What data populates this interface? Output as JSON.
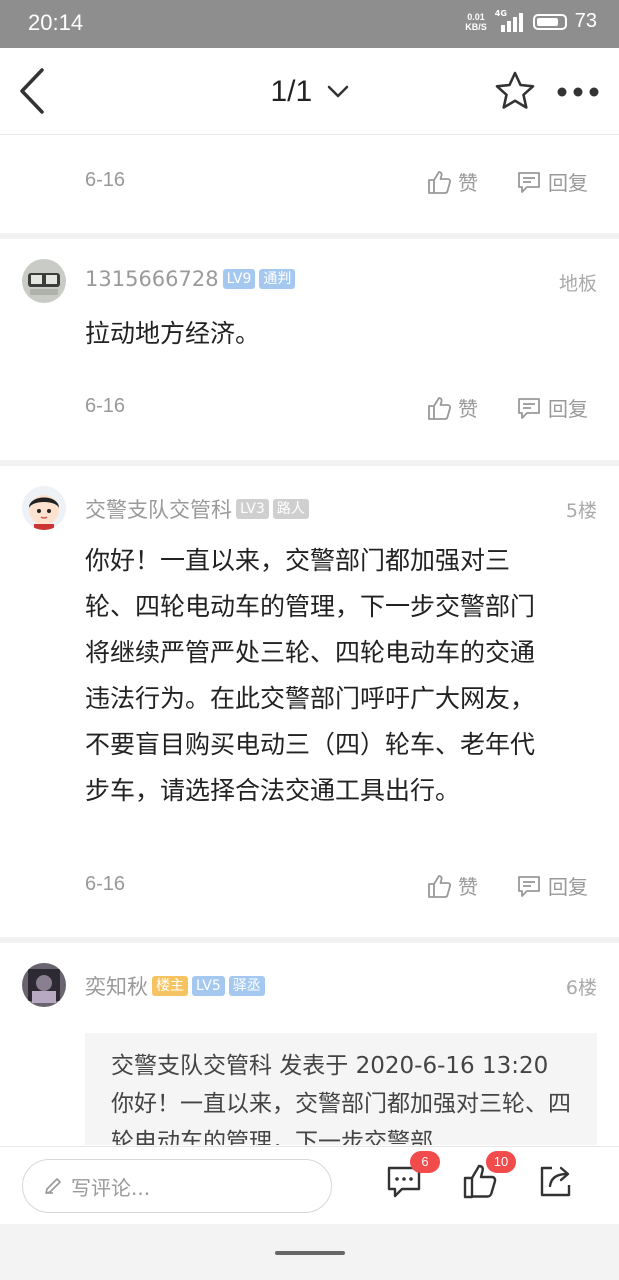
{
  "status_bar": {
    "time": "20:14",
    "net_speed_value": "0.01",
    "net_speed_unit": "KB/S",
    "network": "4G",
    "battery": "73"
  },
  "nav": {
    "page_indicator": "1/1"
  },
  "common": {
    "like_label": "赞",
    "reply_label": "回复"
  },
  "posts": [
    {
      "date": "6-16"
    },
    {
      "username": "1315666728",
      "level": "LV9",
      "title": "通判",
      "floor": "地板",
      "text": "拉动地方经济。",
      "date": "6-16"
    },
    {
      "username": "交警支队交管科",
      "level": "LV3",
      "title": "路人",
      "floor": "5楼",
      "text": "你好！一直以来，交警部门都加强对三轮、四轮电动车的管理，下一步交警部门将继续严管严处三轮、四轮电动车的交通违法行为。在此交警部门呼吁广大网友，不要盲目购买电动三（四）轮车、老年代步车，请选择合法交通工具出行。",
      "date": "6-16"
    },
    {
      "username": "奕知秋",
      "owner_badge": "楼主",
      "level": "LV5",
      "title": "驿丞",
      "floor": "6楼",
      "quote": "交警支队交管科 发表于 2020-6-16 13:20你好！一直以来，交警部门都加强对三轮、四轮电动车的管理，下一步交警部"
    }
  ],
  "bottom_bar": {
    "comment_placeholder": "写评论...",
    "comment_count": "6",
    "like_count": "10"
  }
}
